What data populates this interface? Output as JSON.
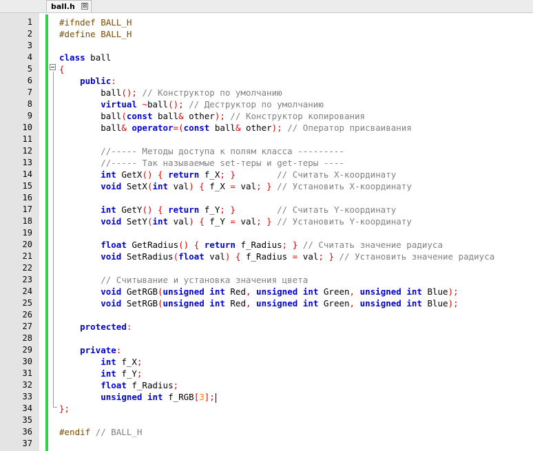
{
  "tab": {
    "title": "ball.h",
    "close": "⊠"
  },
  "lines": [
    {
      "n": "1",
      "t": [
        [
          "pp",
          "#ifndef BALL_H"
        ]
      ]
    },
    {
      "n": "2",
      "t": [
        [
          "pp",
          "#define BALL_H"
        ]
      ]
    },
    {
      "n": "3",
      "t": []
    },
    {
      "n": "4",
      "t": [
        [
          "kw",
          "class"
        ],
        [
          "tx",
          " ball"
        ]
      ]
    },
    {
      "n": "5",
      "t": [
        [
          "op",
          "{"
        ]
      ]
    },
    {
      "n": "6",
      "t": [
        [
          "tx",
          "    "
        ],
        [
          "kw",
          "public"
        ],
        [
          "op",
          ":"
        ]
      ]
    },
    {
      "n": "7",
      "t": [
        [
          "tx",
          "        ball"
        ],
        [
          "op",
          "();"
        ],
        [
          "cm",
          " // Конструктор по умолчанию"
        ]
      ]
    },
    {
      "n": "8",
      "t": [
        [
          "tx",
          "        "
        ],
        [
          "kw",
          "virtual"
        ],
        [
          "tx",
          " "
        ],
        [
          "op",
          "~"
        ],
        [
          "tx",
          "ball"
        ],
        [
          "op",
          "();"
        ],
        [
          "cm",
          " // Деструктор по умолчанию"
        ]
      ]
    },
    {
      "n": "9",
      "t": [
        [
          "tx",
          "        ball"
        ],
        [
          "op",
          "("
        ],
        [
          "kw",
          "const"
        ],
        [
          "tx",
          " ball"
        ],
        [
          "op",
          "&"
        ],
        [
          "tx",
          " other"
        ],
        [
          "op",
          ");"
        ],
        [
          "cm",
          " // Конструктор копирования"
        ]
      ]
    },
    {
      "n": "10",
      "t": [
        [
          "tx",
          "        ball"
        ],
        [
          "op",
          "&"
        ],
        [
          "tx",
          " "
        ],
        [
          "kw",
          "operator"
        ],
        [
          "op",
          "=("
        ],
        [
          "kw",
          "const"
        ],
        [
          "tx",
          " ball"
        ],
        [
          "op",
          "&"
        ],
        [
          "tx",
          " other"
        ],
        [
          "op",
          ");"
        ],
        [
          "cm",
          " // Оператор присваивания"
        ]
      ]
    },
    {
      "n": "11",
      "t": []
    },
    {
      "n": "12",
      "t": [
        [
          "tx",
          "        "
        ],
        [
          "cm",
          "//----- Методы доступа к полям класса ---------"
        ]
      ]
    },
    {
      "n": "13",
      "t": [
        [
          "tx",
          "        "
        ],
        [
          "cm",
          "//----- Так называемые set-теры и get-теры ----"
        ]
      ]
    },
    {
      "n": "14",
      "t": [
        [
          "tx",
          "        "
        ],
        [
          "kw",
          "int"
        ],
        [
          "tx",
          " GetX"
        ],
        [
          "op",
          "()"
        ],
        [
          "tx",
          " "
        ],
        [
          "op",
          "{"
        ],
        [
          "tx",
          " "
        ],
        [
          "kw",
          "return"
        ],
        [
          "tx",
          " f_X"
        ],
        [
          "op",
          ";"
        ],
        [
          "tx",
          " "
        ],
        [
          "op",
          "}"
        ],
        [
          "cm",
          "        // Считать X-координату"
        ]
      ]
    },
    {
      "n": "15",
      "t": [
        [
          "tx",
          "        "
        ],
        [
          "kw",
          "void"
        ],
        [
          "tx",
          " SetX"
        ],
        [
          "op",
          "("
        ],
        [
          "kw",
          "int"
        ],
        [
          "tx",
          " val"
        ],
        [
          "op",
          ")"
        ],
        [
          "tx",
          " "
        ],
        [
          "op",
          "{"
        ],
        [
          "tx",
          " f_X "
        ],
        [
          "op",
          "="
        ],
        [
          "tx",
          " val"
        ],
        [
          "op",
          ";"
        ],
        [
          "tx",
          " "
        ],
        [
          "op",
          "}"
        ],
        [
          "cm",
          " // Установить X-координату"
        ]
      ]
    },
    {
      "n": "16",
      "t": []
    },
    {
      "n": "17",
      "t": [
        [
          "tx",
          "        "
        ],
        [
          "kw",
          "int"
        ],
        [
          "tx",
          " GetY"
        ],
        [
          "op",
          "()"
        ],
        [
          "tx",
          " "
        ],
        [
          "op",
          "{"
        ],
        [
          "tx",
          " "
        ],
        [
          "kw",
          "return"
        ],
        [
          "tx",
          " f_Y"
        ],
        [
          "op",
          ";"
        ],
        [
          "tx",
          " "
        ],
        [
          "op",
          "}"
        ],
        [
          "cm",
          "        // Считать Y-координату"
        ]
      ]
    },
    {
      "n": "18",
      "t": [
        [
          "tx",
          "        "
        ],
        [
          "kw",
          "void"
        ],
        [
          "tx",
          " SetY"
        ],
        [
          "op",
          "("
        ],
        [
          "kw",
          "int"
        ],
        [
          "tx",
          " val"
        ],
        [
          "op",
          ")"
        ],
        [
          "tx",
          " "
        ],
        [
          "op",
          "{"
        ],
        [
          "tx",
          " f_Y "
        ],
        [
          "op",
          "="
        ],
        [
          "tx",
          " val"
        ],
        [
          "op",
          ";"
        ],
        [
          "tx",
          " "
        ],
        [
          "op",
          "}"
        ],
        [
          "cm",
          " // Установить Y-координату"
        ]
      ]
    },
    {
      "n": "19",
      "t": []
    },
    {
      "n": "20",
      "t": [
        [
          "tx",
          "        "
        ],
        [
          "kw",
          "float"
        ],
        [
          "tx",
          " GetRadius"
        ],
        [
          "op",
          "()"
        ],
        [
          "tx",
          " "
        ],
        [
          "op",
          "{"
        ],
        [
          "tx",
          " "
        ],
        [
          "kw",
          "return"
        ],
        [
          "tx",
          " f_Radius"
        ],
        [
          "op",
          ";"
        ],
        [
          "tx",
          " "
        ],
        [
          "op",
          "}"
        ],
        [
          "cm",
          " // Считать значение радиуса"
        ]
      ]
    },
    {
      "n": "21",
      "t": [
        [
          "tx",
          "        "
        ],
        [
          "kw",
          "void"
        ],
        [
          "tx",
          " SetRadius"
        ],
        [
          "op",
          "("
        ],
        [
          "kw",
          "float"
        ],
        [
          "tx",
          " val"
        ],
        [
          "op",
          ")"
        ],
        [
          "tx",
          " "
        ],
        [
          "op",
          "{"
        ],
        [
          "tx",
          " f_Radius "
        ],
        [
          "op",
          "="
        ],
        [
          "tx",
          " val"
        ],
        [
          "op",
          ";"
        ],
        [
          "tx",
          " "
        ],
        [
          "op",
          "}"
        ],
        [
          "cm",
          " // Установить значение радиуса"
        ]
      ]
    },
    {
      "n": "22",
      "t": []
    },
    {
      "n": "23",
      "t": [
        [
          "tx",
          "        "
        ],
        [
          "cm",
          "// Считывание и установка значения цвета"
        ]
      ]
    },
    {
      "n": "24",
      "t": [
        [
          "tx",
          "        "
        ],
        [
          "kw",
          "void"
        ],
        [
          "tx",
          " GetRGB"
        ],
        [
          "op",
          "("
        ],
        [
          "kw",
          "unsigned"
        ],
        [
          "tx",
          " "
        ],
        [
          "kw",
          "int"
        ],
        [
          "tx",
          " Red"
        ],
        [
          "op",
          ","
        ],
        [
          "tx",
          " "
        ],
        [
          "kw",
          "unsigned"
        ],
        [
          "tx",
          " "
        ],
        [
          "kw",
          "int"
        ],
        [
          "tx",
          " Green"
        ],
        [
          "op",
          ","
        ],
        [
          "tx",
          " "
        ],
        [
          "kw",
          "unsigned"
        ],
        [
          "tx",
          " "
        ],
        [
          "kw",
          "int"
        ],
        [
          "tx",
          " Blue"
        ],
        [
          "op",
          ");"
        ]
      ]
    },
    {
      "n": "25",
      "t": [
        [
          "tx",
          "        "
        ],
        [
          "kw",
          "void"
        ],
        [
          "tx",
          " SetRGB"
        ],
        [
          "op",
          "("
        ],
        [
          "kw",
          "unsigned"
        ],
        [
          "tx",
          " "
        ],
        [
          "kw",
          "int"
        ],
        [
          "tx",
          " Red"
        ],
        [
          "op",
          ","
        ],
        [
          "tx",
          " "
        ],
        [
          "kw",
          "unsigned"
        ],
        [
          "tx",
          " "
        ],
        [
          "kw",
          "int"
        ],
        [
          "tx",
          " Green"
        ],
        [
          "op",
          ","
        ],
        [
          "tx",
          " "
        ],
        [
          "kw",
          "unsigned"
        ],
        [
          "tx",
          " "
        ],
        [
          "kw",
          "int"
        ],
        [
          "tx",
          " Blue"
        ],
        [
          "op",
          ");"
        ]
      ]
    },
    {
      "n": "26",
      "t": []
    },
    {
      "n": "27",
      "t": [
        [
          "tx",
          "    "
        ],
        [
          "kw",
          "protected"
        ],
        [
          "op",
          ":"
        ]
      ]
    },
    {
      "n": "28",
      "t": []
    },
    {
      "n": "29",
      "t": [
        [
          "tx",
          "    "
        ],
        [
          "kw",
          "private"
        ],
        [
          "op",
          ":"
        ]
      ]
    },
    {
      "n": "30",
      "t": [
        [
          "tx",
          "        "
        ],
        [
          "kw",
          "int"
        ],
        [
          "tx",
          " f_X"
        ],
        [
          "op",
          ";"
        ]
      ]
    },
    {
      "n": "31",
      "t": [
        [
          "tx",
          "        "
        ],
        [
          "kw",
          "int"
        ],
        [
          "tx",
          " f_Y"
        ],
        [
          "op",
          ";"
        ]
      ]
    },
    {
      "n": "32",
      "t": [
        [
          "tx",
          "        "
        ],
        [
          "kw",
          "float"
        ],
        [
          "tx",
          " f_Radius"
        ],
        [
          "op",
          ";"
        ]
      ]
    },
    {
      "n": "33",
      "t": [
        [
          "tx",
          "        "
        ],
        [
          "kw",
          "unsigned"
        ],
        [
          "tx",
          " "
        ],
        [
          "kw",
          "int"
        ],
        [
          "tx",
          " f_RGB"
        ],
        [
          "op",
          "["
        ],
        [
          "nm",
          "3"
        ],
        [
          "op",
          "];"
        ]
      ]
    },
    {
      "n": "34",
      "t": [
        [
          "op",
          "};"
        ]
      ]
    },
    {
      "n": "35",
      "t": []
    },
    {
      "n": "36",
      "t": [
        [
          "pp",
          "#endif"
        ],
        [
          "cm",
          " // BALL_H"
        ]
      ]
    },
    {
      "n": "37",
      "t": []
    }
  ]
}
